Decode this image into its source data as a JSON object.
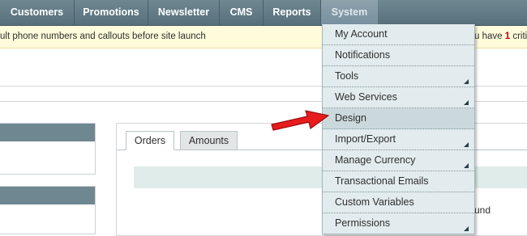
{
  "nav": {
    "items": [
      {
        "label": "Customers"
      },
      {
        "label": "Promotions"
      },
      {
        "label": "Newsletter"
      },
      {
        "label": "CMS"
      },
      {
        "label": "Reports"
      },
      {
        "label": "System"
      }
    ]
  },
  "notice": {
    "left_text": "ult phone numbers and callouts before site launch",
    "right_prefix": "u have ",
    "right_count": "1",
    "right_suffix": " criti"
  },
  "tabs": {
    "orders": "Orders",
    "amounts": "Amounts"
  },
  "behind_text": "und",
  "system_menu": {
    "items": [
      {
        "label": "My Account"
      },
      {
        "label": "Notifications"
      },
      {
        "label": "Tools"
      },
      {
        "label": "Web Services"
      },
      {
        "label": "Design"
      },
      {
        "label": "Import/Export"
      },
      {
        "label": "Manage Currency"
      },
      {
        "label": "Transactional Emails"
      },
      {
        "label": "Custom Variables"
      },
      {
        "label": "Permissions"
      }
    ]
  },
  "colors": {
    "nav_bg": "#5f7884",
    "menu_bg": "#e2ebed",
    "highlight_bg": "#cbd9dc",
    "notice_bg": "#fffbdb",
    "arrow_red": "#e81c1c"
  }
}
